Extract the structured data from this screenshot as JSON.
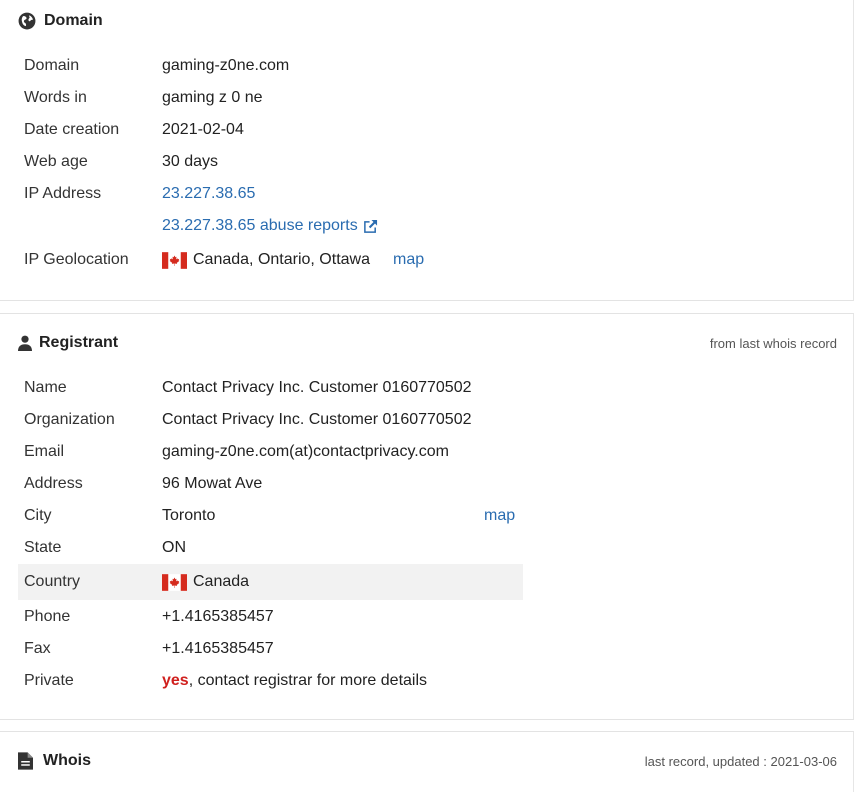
{
  "domain_panel": {
    "title": "Domain",
    "domain": {
      "label": "Domain",
      "value": "gaming-z0ne.com"
    },
    "words": {
      "label": "Words in",
      "value": "gaming z 0 ne"
    },
    "created": {
      "label": "Date creation",
      "value": "2021-02-04"
    },
    "age": {
      "label": "Web age",
      "value": "30 days"
    },
    "ip": {
      "label": "IP Address",
      "value": "23.227.38.65",
      "abuse": "23.227.38.65 abuse reports"
    },
    "geo": {
      "label": "IP Geolocation",
      "value": "Canada, Ontario, Ottawa",
      "map": "map"
    }
  },
  "registrant_panel": {
    "title": "Registrant",
    "note": "from last whois record",
    "name": {
      "label": "Name",
      "value": "Contact Privacy Inc. Customer 0160770502"
    },
    "org": {
      "label": "Organization",
      "value": "Contact Privacy Inc. Customer 0160770502"
    },
    "email": {
      "label": "Email",
      "value": "gaming-z0ne.com(at)contactprivacy.com"
    },
    "address": {
      "label": "Address",
      "value": "96 Mowat Ave"
    },
    "city": {
      "label": "City",
      "value": "Toronto",
      "map": "map"
    },
    "state": {
      "label": "State",
      "value": "ON"
    },
    "country": {
      "label": "Country",
      "value": "Canada"
    },
    "phone": {
      "label": "Phone",
      "value": "+1.4165385457"
    },
    "fax": {
      "label": "Fax",
      "value": "+1.4165385457"
    },
    "private": {
      "label": "Private",
      "yes": "yes",
      "rest": ", contact registrar for more details"
    }
  },
  "whois_panel": {
    "title": "Whois",
    "note": "last record, updated : 2021-03-06"
  },
  "colors": {
    "link": "#2a6cb0",
    "alert": "#d0201e",
    "flag_red": "#d52b1e"
  }
}
